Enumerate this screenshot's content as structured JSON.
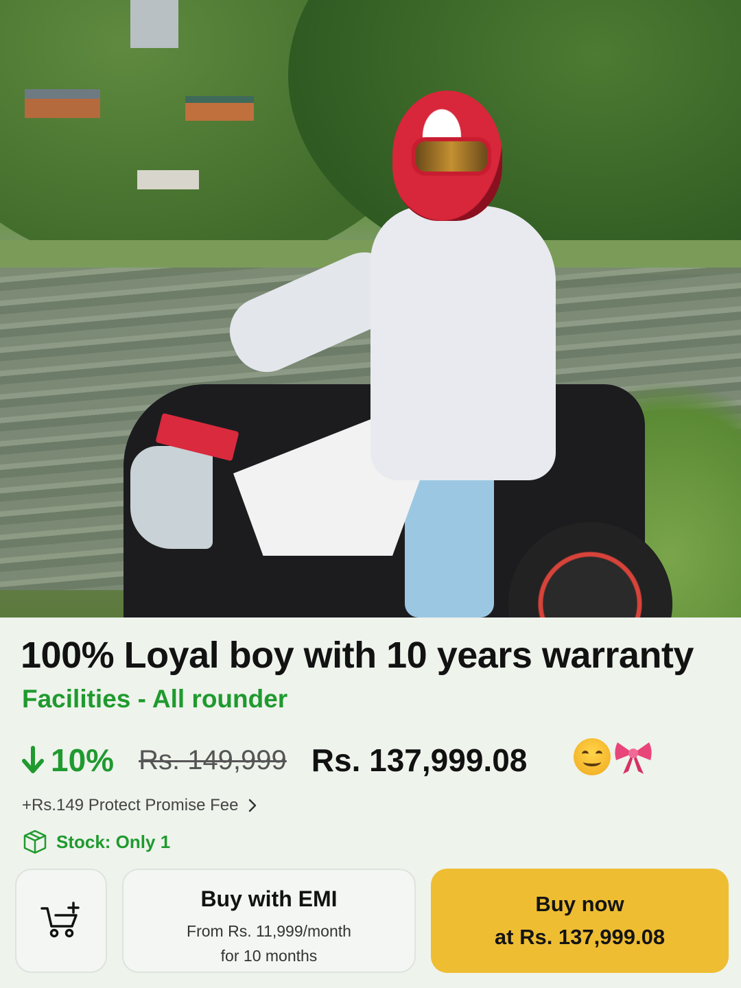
{
  "product": {
    "title": "100% Loyal boy with 10 years warranty",
    "subtitle": "Facilities - All rounder"
  },
  "pricing": {
    "discount": "10%",
    "original_price": "Rs. 149,999",
    "current_price": "Rs. 137,999.08",
    "emojis": [
      "smiling-face",
      "ribbon-bow"
    ]
  },
  "fee": {
    "label": "+Rs.149 Protect Promise Fee"
  },
  "stock": {
    "label": "Stock: Only 1"
  },
  "actions": {
    "emi_title": "Buy with EMI",
    "emi_line1": "From Rs. 11,999/month",
    "emi_line2": "for 10 months",
    "buy_line1": "Buy now",
    "buy_line2": "at Rs. 137,999.08"
  },
  "colors": {
    "accent_green": "#1f9a2e",
    "buy_button": "#eebd32",
    "background": "#eef3ec"
  },
  "icons": [
    "arrow-down-icon",
    "chevron-right-icon",
    "box-icon",
    "cart-add-icon"
  ]
}
